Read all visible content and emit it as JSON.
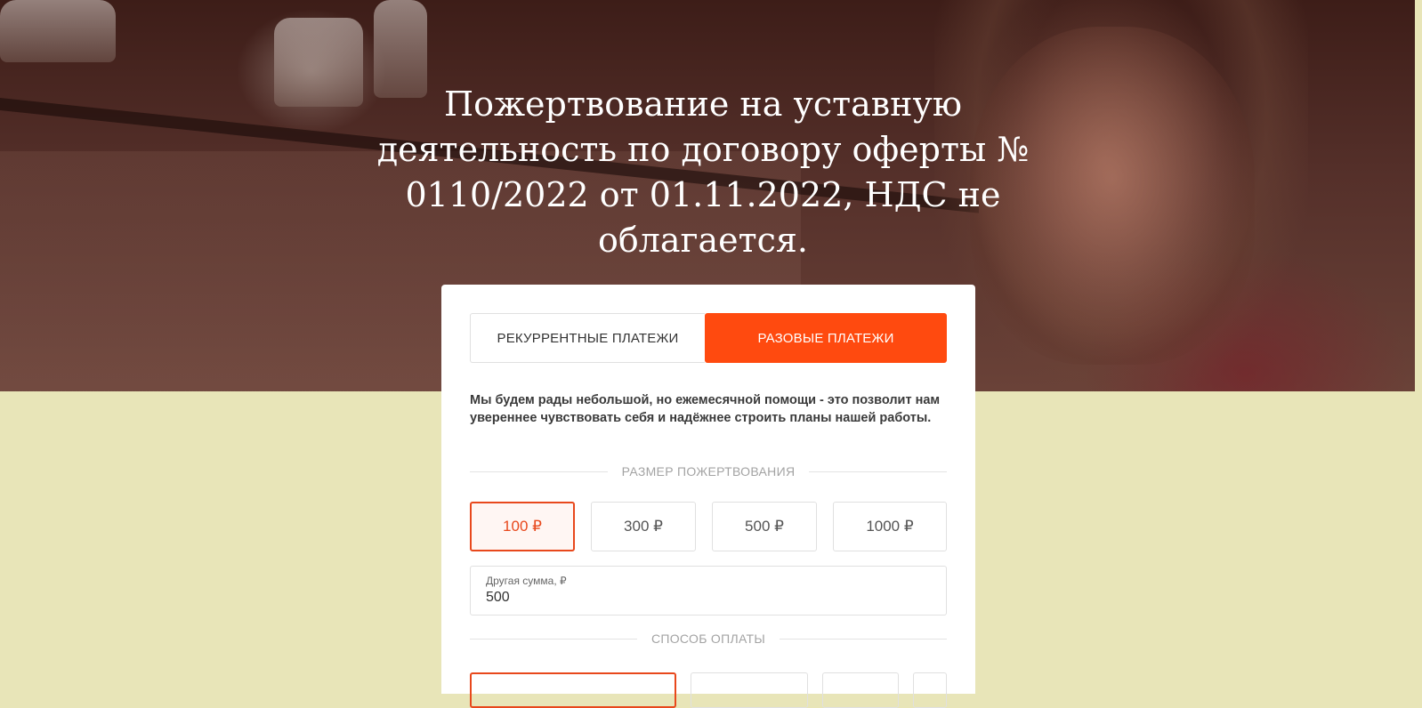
{
  "hero": {
    "title": "Пожертвование на уставную деятельность по договору оферты № 0110/2022 от 01.11.2022, НДС не облагается."
  },
  "tabs": {
    "recurring_label": "РЕКУРРЕНТНЫЕ ПЛАТЕЖИ",
    "once_label": "РАЗОВЫЕ ПЛАТЕЖИ",
    "active": "once"
  },
  "intro_text": "Мы будем рады небольшой, но ежемесячной помощи - это позволит нам увереннее чувствовать себя и надёжнее строить планы нашей работы.",
  "donation": {
    "section_label": "РАЗМЕР ПОЖЕРТВОВАНИЯ",
    "amounts": [
      "100 ₽",
      "300 ₽",
      "500 ₽",
      "1000 ₽"
    ],
    "selected_index": 0,
    "other_label": "Другая сумма, ₽",
    "other_value": "500"
  },
  "payment": {
    "section_label": "СПОСОБ ОПЛАТЫ",
    "selected_index": 0
  },
  "colors": {
    "accent": "#ff4a0f",
    "page_background": "#e8e5b8"
  }
}
